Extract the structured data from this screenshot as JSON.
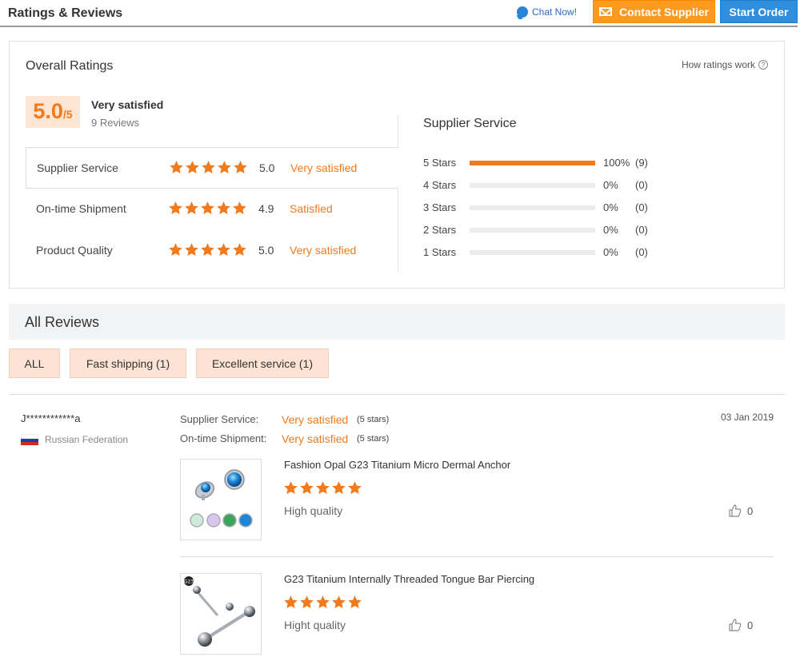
{
  "header": {
    "title": "Ratings & Reviews",
    "chat_label": "Chat Now!",
    "contact_label": "Contact Supplier",
    "start_label": "Start Order"
  },
  "overall": {
    "title": "Overall Ratings",
    "how_label": "How ratings work",
    "score": "5.0",
    "score_max": "/5",
    "score_label": "Very satisfied",
    "review_count": "9 Reviews",
    "metrics": [
      {
        "name": "Supplier Service",
        "stars": 5,
        "score": "5.0",
        "text": "Very satisfied"
      },
      {
        "name": "On-time Shipment",
        "stars": 5,
        "score": "4.9",
        "text": "Satisfied"
      },
      {
        "name": "Product Quality",
        "stars": 5,
        "score": "5.0",
        "text": "Very satisfied"
      }
    ]
  },
  "breakdown": {
    "title": "Supplier Service",
    "rows": [
      {
        "label": "5  Stars",
        "fraction": 1.0,
        "pct": "100%",
        "count": "(9)"
      },
      {
        "label": "4  Stars",
        "fraction": 0,
        "pct": "0%",
        "count": "(0)"
      },
      {
        "label": "3  Stars",
        "fraction": 0,
        "pct": "0%",
        "count": "(0)"
      },
      {
        "label": "2  Stars",
        "fraction": 0,
        "pct": "0%",
        "count": "(0)"
      },
      {
        "label": "1  Stars",
        "fraction": 0,
        "pct": "0%",
        "count": "(0)"
      }
    ]
  },
  "reviews": {
    "title": "All Reviews",
    "filters": [
      "ALL",
      "Fast shipping (1)",
      "Excellent service (1)"
    ],
    "item": {
      "reviewer": "J************a",
      "country": "Russian Federation",
      "date": "03 Jan 2019",
      "supplier_service_label": "Supplier Service:",
      "supplier_service_value": "Very satisfied",
      "supplier_service_note": "(5 stars)",
      "shipment_label": "On-time Shipment:",
      "shipment_value": "Very satisfied",
      "shipment_note": "(5 stars)",
      "products": [
        {
          "title": "Fashion Opal G23 Titanium Micro Dermal Anchor",
          "stars": 5,
          "comment": "High quality",
          "likes": "0"
        },
        {
          "title": "G23 Titanium Internally Threaded Tongue Bar Piercing",
          "stars": 5,
          "comment": "Hight quality",
          "likes": "0"
        }
      ]
    }
  },
  "colors": {
    "accent": "#f07a1c",
    "contact_button": "#ff9a1e",
    "start_button": "#2f8fde",
    "badge_bg": "#fde5d4"
  },
  "icons": [
    "chat-icon",
    "envelope-icon",
    "question-icon",
    "star-icon",
    "flag-icon",
    "thumbs-up-icon"
  ]
}
